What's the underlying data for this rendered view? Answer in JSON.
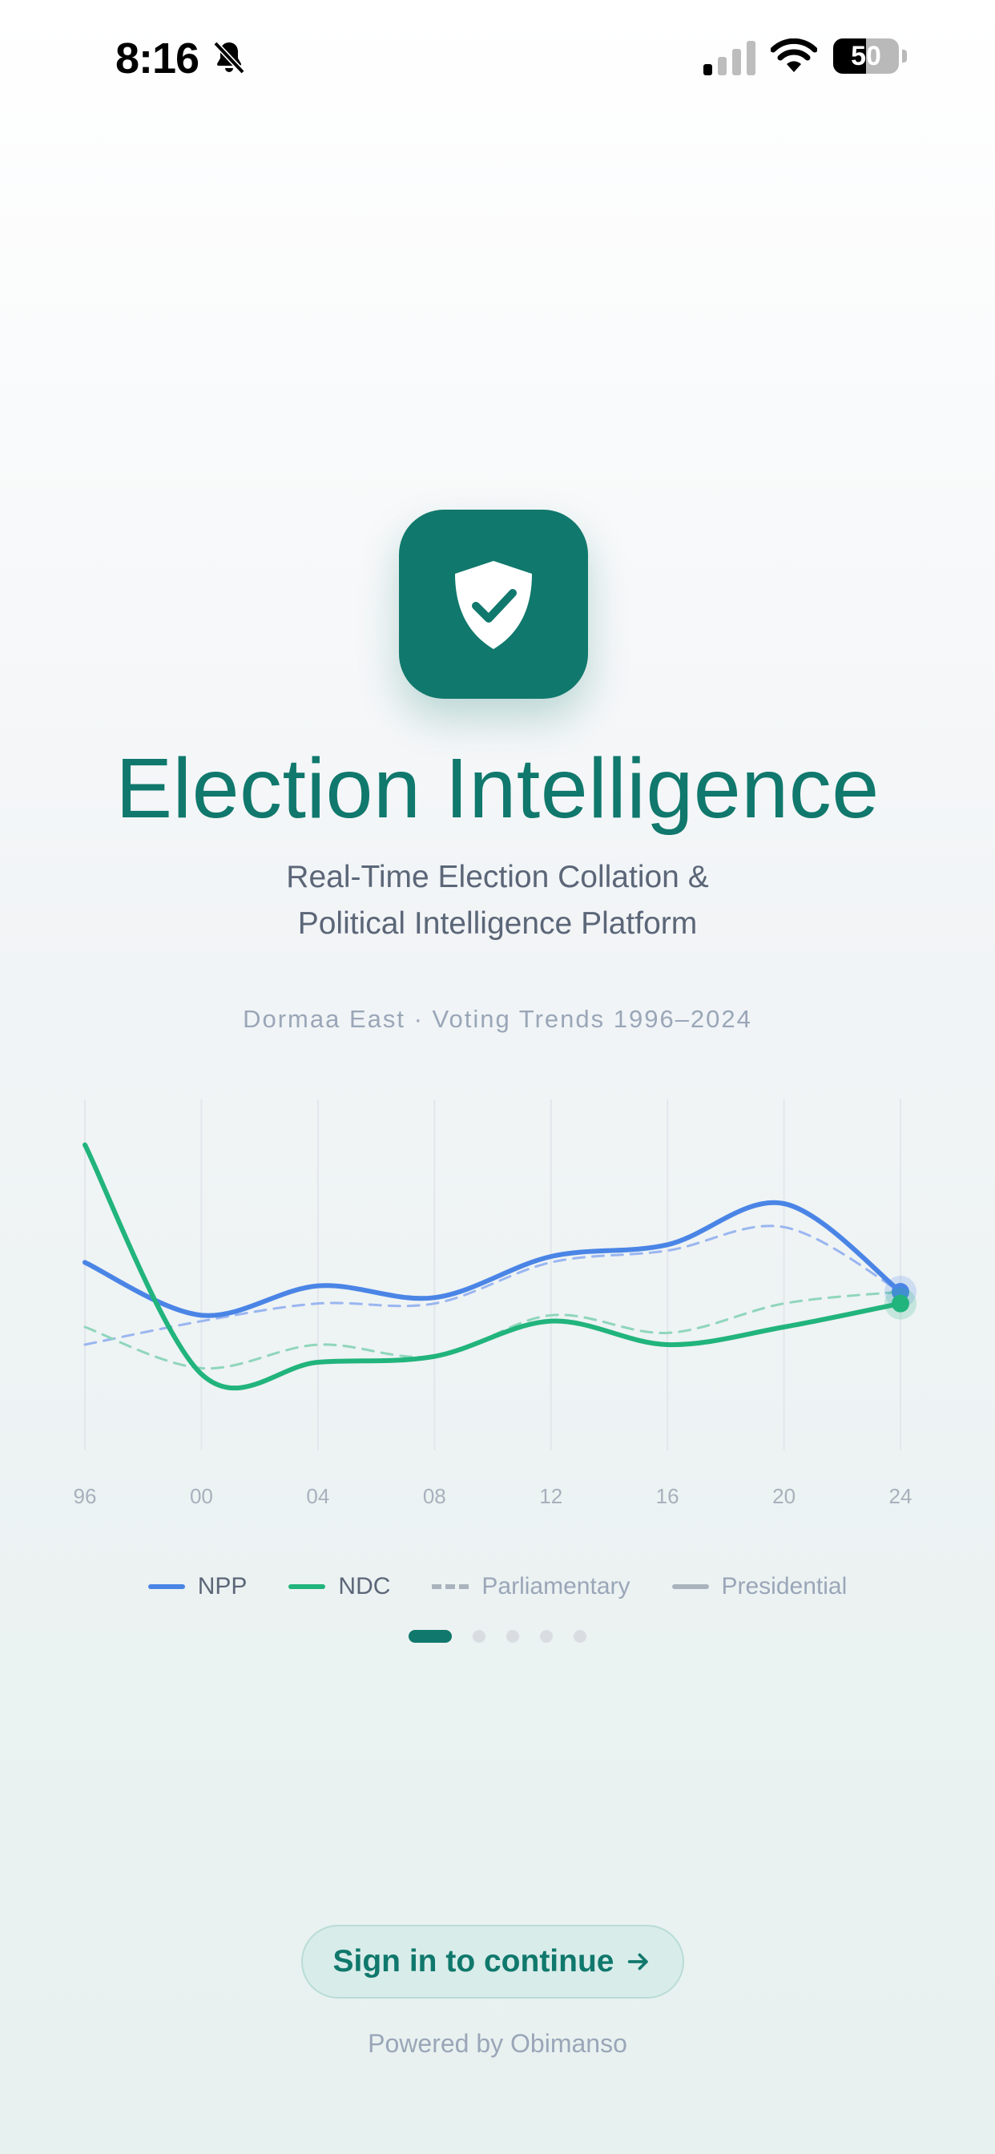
{
  "status_bar": {
    "time": "8:16",
    "battery_percent": 50,
    "battery_label": "50"
  },
  "app": {
    "title": "Election Intelligence",
    "subtitle_line1": "Real-Time Election Collation &",
    "subtitle_line2": "Political Intelligence Platform"
  },
  "chart_data": {
    "type": "line",
    "title": "Dormaa East · Voting Trends 1996–2024",
    "categories": [
      "96",
      "00",
      "04",
      "08",
      "12",
      "16",
      "20",
      "24"
    ],
    "series": [
      {
        "name": "NPP",
        "kind": "Presidential",
        "color": "#4a85e6",
        "dashed": false,
        "values": [
          52,
          43,
          48,
          46,
          53,
          55,
          62,
          47
        ]
      },
      {
        "name": "NDC",
        "kind": "Presidential",
        "color": "#21b47c",
        "dashed": false,
        "values": [
          72,
          33,
          35,
          36,
          42,
          38,
          41,
          45
        ]
      },
      {
        "name": "NPP",
        "kind": "Parliamentary",
        "color": "#9ab6f0",
        "dashed": true,
        "values": [
          38,
          42,
          45,
          45,
          52,
          54,
          58,
          47
        ]
      },
      {
        "name": "NDC",
        "kind": "Parliamentary",
        "color": "#8fd6bb",
        "dashed": true,
        "values": [
          41,
          34,
          38,
          36,
          43,
          40,
          45,
          47
        ]
      }
    ],
    "ylim": [
      20,
      80
    ],
    "grid": "vertical",
    "legend_position": "bottom"
  },
  "legend": {
    "npp": "NPP",
    "ndc": "NDC",
    "parliamentary": "Parliamentary",
    "presidential": "Presidential",
    "npp_color": "#4a85e6",
    "ndc_color": "#21b47c"
  },
  "pager": {
    "count": 5,
    "active": 0
  },
  "actions": {
    "signin_label": "Sign in to continue",
    "signin_icon": "arrow-right-icon"
  },
  "footer": {
    "powered_by": "Powered by Obimanso"
  },
  "colors": {
    "brand": "#10786c"
  }
}
